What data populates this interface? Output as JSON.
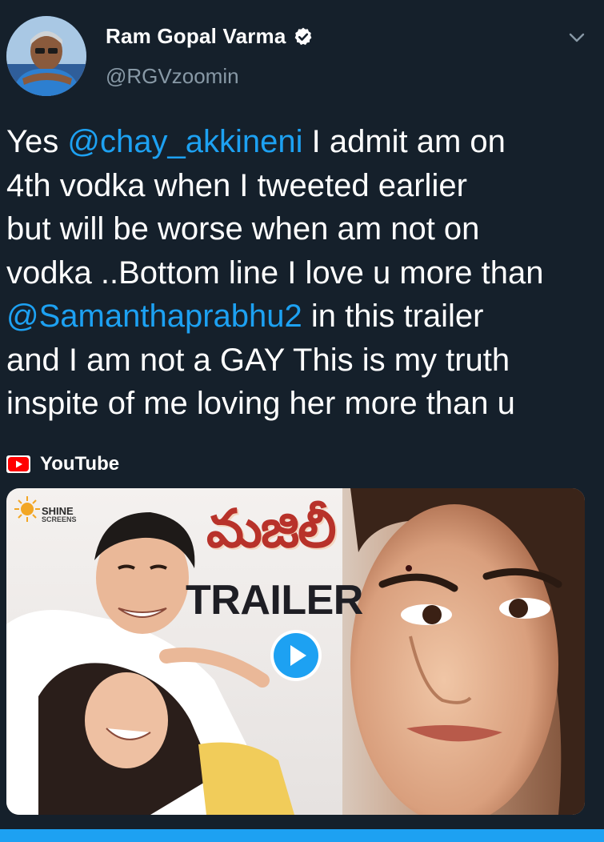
{
  "author": {
    "name": "Ram Gopal Varma",
    "handle": "@RGVzoomin",
    "verified": true
  },
  "tweet": {
    "segments": [
      {
        "text": "Yes ",
        "type": "text"
      },
      {
        "text": "@chay_akkineni",
        "type": "mention"
      },
      {
        "text": " I admit am on\n4th vodka when I tweeted earlier\nbut will be worse when am not on\nvodka ..Bottom line I love u more than\n",
        "type": "text"
      },
      {
        "text": "@Samanthaprabhu2",
        "type": "mention"
      },
      {
        "text": " in this trailer\nand I am not a GAY This is my truth\ninspite of me loving her more than u",
        "type": "text"
      }
    ]
  },
  "link_card": {
    "source": "YouTube",
    "thumbnail": {
      "studio_name": "SHINE",
      "studio_sub": "SCREENS",
      "title_telugu": "మజిలీ",
      "title_label": "TRAILER"
    }
  },
  "colors": {
    "background": "#15202b",
    "mention": "#1da1f2",
    "secondary_text": "#8899a6",
    "youtube_red": "#ff0000",
    "play_button": "#1da1f2"
  },
  "icons": {
    "verified": "verified-badge-icon",
    "menu": "chevron-down-icon",
    "source": "youtube-icon",
    "play": "play-icon"
  }
}
